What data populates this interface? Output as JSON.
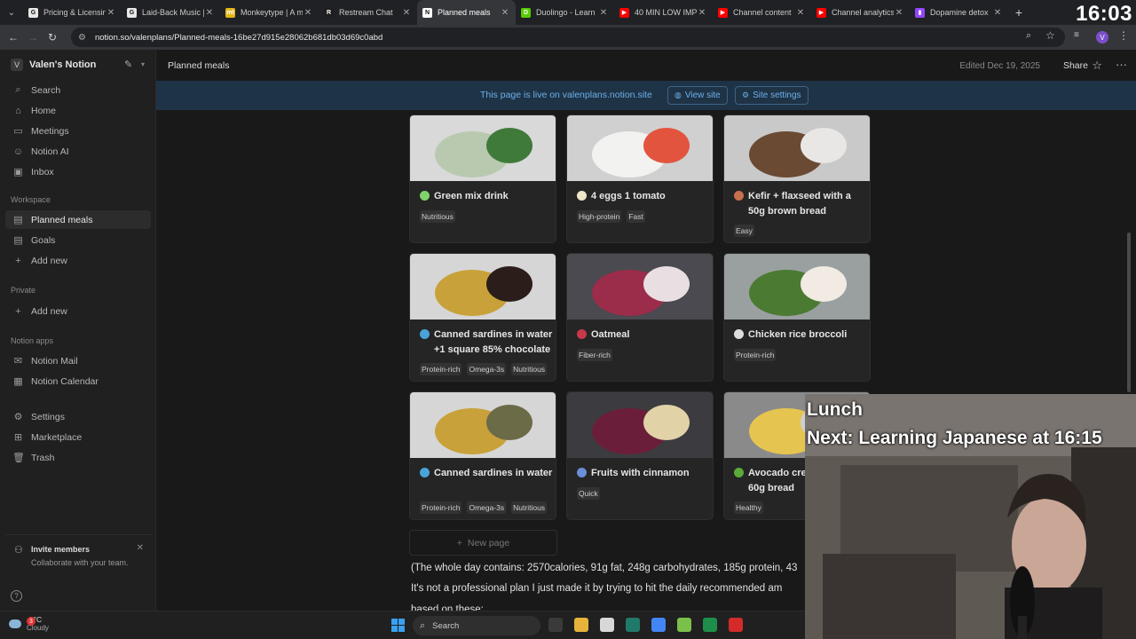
{
  "browser": {
    "tabs": [
      {
        "title": "Pricing & Licensin",
        "icon": "g-icon",
        "color": "#e8e8e8",
        "glyph": "G"
      },
      {
        "title": "Laid-Back Music |",
        "icon": "g-icon",
        "color": "#e8e8e8",
        "glyph": "G"
      },
      {
        "title": "Monkeytype | A m",
        "icon": "monkeytype-icon",
        "color": "#e2b714",
        "glyph": "mt"
      },
      {
        "title": "Restream Chat",
        "icon": "restream-icon",
        "color": "#1e1e1e",
        "glyph": "R"
      },
      {
        "title": "Planned meals",
        "icon": "notion-icon",
        "color": "#ffffff",
        "glyph": "N",
        "active": true
      },
      {
        "title": "Duolingo - Learn",
        "icon": "duolingo-icon",
        "color": "#58cc02",
        "glyph": "D"
      },
      {
        "title": "40 MIN LOW IMP",
        "icon": "youtube-icon",
        "color": "#ff0000",
        "glyph": "▶"
      },
      {
        "title": "Channel content",
        "icon": "youtube-icon",
        "color": "#ff0000",
        "glyph": "▶"
      },
      {
        "title": "Channel analytics",
        "icon": "youtube-icon",
        "color": "#ff0000",
        "glyph": "▶"
      },
      {
        "title": "Dopamine detox",
        "icon": "twitch-icon",
        "color": "#9146ff",
        "glyph": "▮"
      }
    ],
    "url": "notion.so/valenplans/Planned-meals-16be27d915e28062b681db03d69c0abd",
    "clock": "16:03",
    "profile_initial": "V"
  },
  "sidebar": {
    "workspace_initial": "V",
    "workspace_name": "Valen's Notion",
    "top_items": [
      {
        "label": "Search",
        "icon": "search-icon"
      },
      {
        "label": "Home",
        "icon": "home-icon"
      },
      {
        "label": "Meetings",
        "icon": "meetings-icon"
      },
      {
        "label": "Notion AI",
        "icon": "notion-ai-icon"
      },
      {
        "label": "Inbox",
        "icon": "inbox-icon"
      }
    ],
    "workspace_label": "Workspace",
    "workspace_items": [
      {
        "label": "Planned meals",
        "icon": "page-icon",
        "selected": true
      },
      {
        "label": "Goals",
        "icon": "page-icon"
      },
      {
        "label": "Add new",
        "icon": "plus-icon"
      }
    ],
    "private_label": "Private",
    "private_items": [
      {
        "label": "Add new",
        "icon": "plus-icon"
      }
    ],
    "apps_label": "Notion apps",
    "apps_items": [
      {
        "label": "Notion Mail",
        "icon": "mail-icon"
      },
      {
        "label": "Notion Calendar",
        "icon": "calendar-icon"
      }
    ],
    "bottom_items": [
      {
        "label": "Settings",
        "icon": "settings-icon"
      },
      {
        "label": "Marketplace",
        "icon": "marketplace-icon"
      },
      {
        "label": "Trash",
        "icon": "trash-icon"
      }
    ],
    "invite_title": "Invite members",
    "invite_subtitle": "Collaborate with your team."
  },
  "header": {
    "breadcrumb": "Planned meals",
    "edited": "Edited Dec 19, 2025",
    "share": "Share"
  },
  "banner": {
    "text": "This page is live on valenplans.notion.site",
    "view_site": "View site",
    "site_settings": "Site settings"
  },
  "cards": [
    {
      "title": "Green mix drink",
      "tags": [
        "Nutritious"
      ],
      "icon_color": "#7fd36a",
      "img": [
        "#d9d9d9",
        "#b9c9b0",
        "#3f7a3a"
      ]
    },
    {
      "title": "4 eggs 1 tomato",
      "tags": [
        "High-protein",
        "Fast"
      ],
      "icon_color": "#f0e6c8",
      "img": [
        "#d0d0d0",
        "#f2f2f0",
        "#e3543e"
      ]
    },
    {
      "title": "Kefir + flaxseed with a 50g brown bread",
      "tags": [
        "Easy"
      ],
      "icon_color": "#c8704e",
      "img": [
        "#c9c9c9",
        "#6a4a33",
        "#e9e6e6"
      ]
    },
    {
      "title": "Canned sardines in water +1 square 85% chocolate",
      "tags": [
        "Protein-rich",
        "Omega-3s",
        "Nutritious"
      ],
      "icon_color": "#4aa3d8",
      "img": [
        "#d6d6d6",
        "#c9a13a",
        "#2a1d1a"
      ]
    },
    {
      "title": "Oatmeal",
      "tags": [
        "Fiber-rich"
      ],
      "icon_color": "#c8384a",
      "img": [
        "#4a4a50",
        "#9b2c4a",
        "#e9dfe3"
      ]
    },
    {
      "title": "Chicken rice broccoli",
      "tags": [
        "Protein-rich"
      ],
      "icon_color": "#dddddd",
      "img": [
        "#9aa0a0",
        "#4b7a32",
        "#f1ebe3"
      ]
    },
    {
      "title": "Canned sardines in water",
      "tags": [
        "Protein-rich",
        "Omega-3s",
        "Nutritious"
      ],
      "icon_color": "#4aa3d8",
      "img": [
        "#d6d6d6",
        "#c9a13a",
        "#6b6b48"
      ]
    },
    {
      "title": "Fruits with cinnamon",
      "tags": [
        "Quick"
      ],
      "icon_color": "#6a8fd8",
      "img": [
        "#3c3c40",
        "#6b1e3a",
        "#e2d2a8"
      ]
    },
    {
      "title": "Avocado cream cheese 60g bread",
      "tags": [
        "Healthy"
      ],
      "icon_color": "#5aaa3a",
      "img": [
        "#8a8a8a",
        "#e5c550",
        "#cfcfcf"
      ]
    }
  ],
  "new_page": "New page",
  "body": {
    "line1": "(The whole day contains: 2570calories, 91g fat, 248g carbohydrates, 185g protein, 43",
    "line2": "It's not a professional plan I just made it by trying to hit the daily recommended am",
    "line3": "based on these:"
  },
  "overlay": {
    "line1": "Lunch",
    "line2": "Next: Learning Japanese at 16:15"
  },
  "taskbar": {
    "notif_count": "3",
    "temp": "-3°C",
    "condition": "Cloudy",
    "search": "Search",
    "apps": [
      {
        "icon": "terminal-icon",
        "color": "#3a3a3a"
      },
      {
        "icon": "file-explorer-icon",
        "color": "#e8b33a"
      },
      {
        "icon": "obs-icon",
        "color": "#d8d8d8"
      },
      {
        "icon": "monitor-icon",
        "color": "#1f7a6a"
      },
      {
        "icon": "chrome-icon",
        "color": "#4285f4"
      },
      {
        "icon": "sheets-icon",
        "color": "#7ac04a"
      },
      {
        "icon": "spreadsheet-icon",
        "color": "#1d8f4a"
      },
      {
        "icon": "record-icon",
        "color": "#d42a2a"
      }
    ]
  }
}
